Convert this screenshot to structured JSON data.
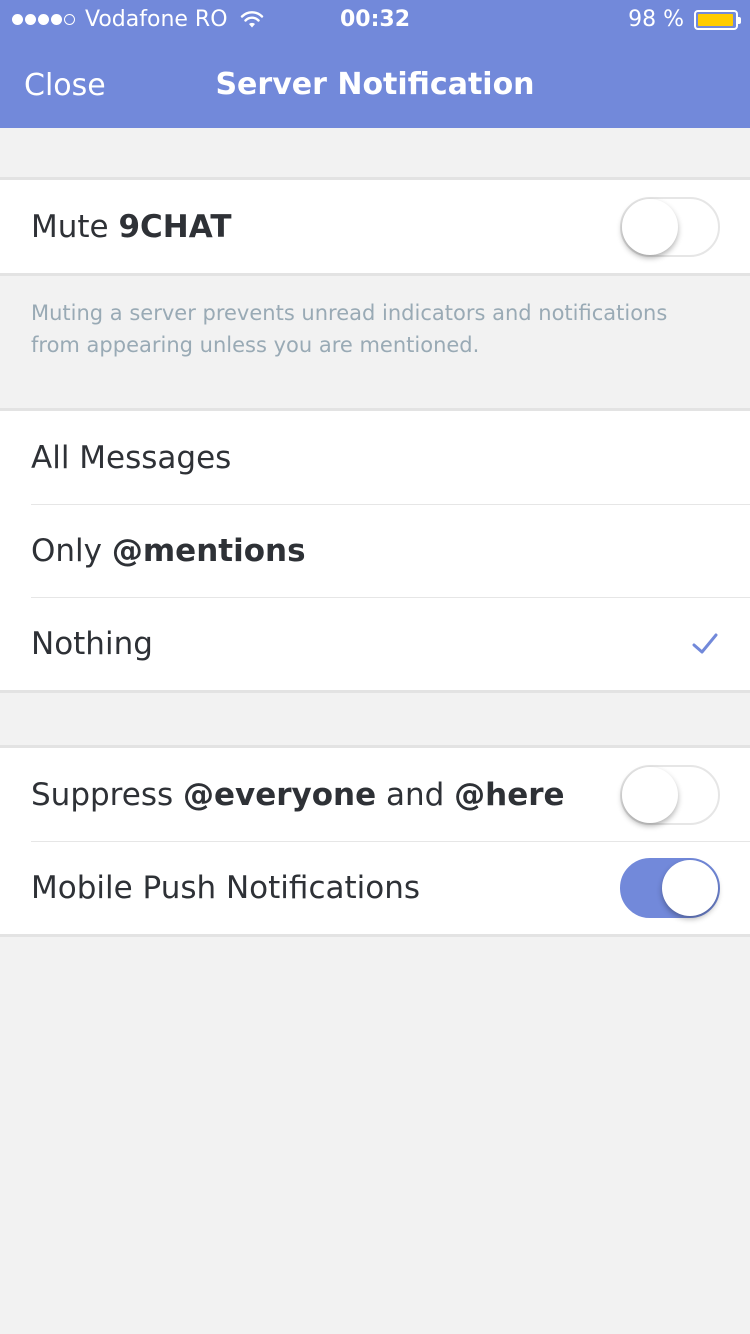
{
  "status_bar": {
    "carrier": "Vodafone RO",
    "time": "00:32",
    "battery_text": "98 %",
    "battery_level": 0.98,
    "signal_bars_filled": 4,
    "signal_bars_total": 5
  },
  "nav": {
    "close_label": "Close",
    "title": "Server Notification"
  },
  "mute": {
    "label_prefix": "Mute ",
    "server_name": "9CHAT",
    "toggle_on": false
  },
  "mute_note": "Muting a server prevents unread indicators and notifications from appearing unless you are mentioned.",
  "options": {
    "all_messages": "All Messages",
    "only_prefix": "Only ",
    "only_mentions": "@mentions",
    "nothing": "Nothing",
    "selected": "nothing"
  },
  "suppress": {
    "prefix": "Suppress ",
    "everyone": "@everyone",
    "and": " and ",
    "here": "@here",
    "toggle_on": false
  },
  "push": {
    "label": "Mobile Push Notifications",
    "toggle_on": true
  },
  "colors": {
    "accent": "#7289da",
    "battery": "#ffcc00",
    "background": "#f2f2f2",
    "note_text": "#99aab5"
  },
  "icons": {
    "wifi": "wifi-icon",
    "battery": "battery-icon",
    "selected_check": "checkmark-icon"
  }
}
